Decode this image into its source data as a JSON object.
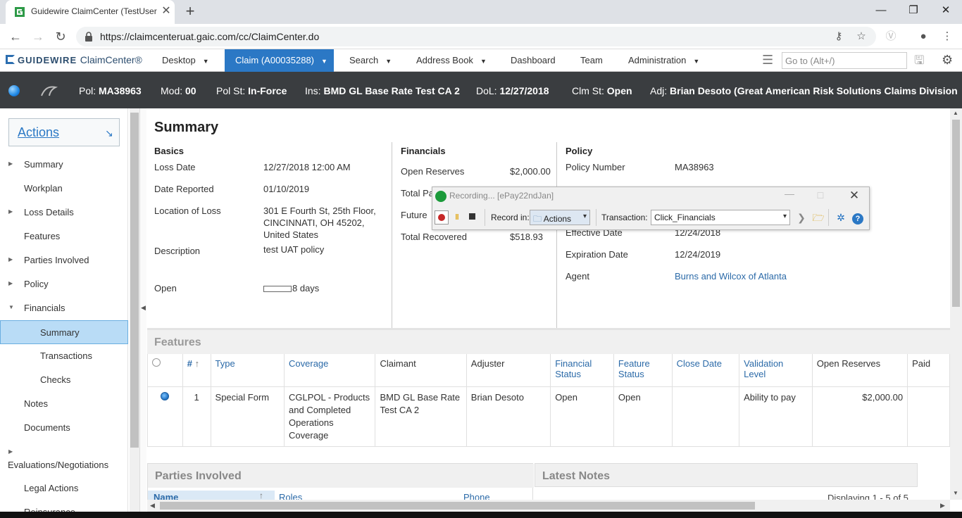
{
  "browser": {
    "tab_title": "Guidewire ClaimCenter (TestUser",
    "url": "https://claimcenteruat.gaic.com/cc/ClaimCenter.do"
  },
  "nav": {
    "logo": "GUIDEWIRE",
    "product": "ClaimCenter®",
    "items": [
      "Desktop",
      "Claim (A00035288)",
      "Search",
      "Address Book",
      "Dashboard",
      "Team",
      "Administration"
    ],
    "goto_placeholder": "Go to (Alt+/)"
  },
  "infobar": {
    "pol_label": "Pol:",
    "pol": "MA38963",
    "mod_label": "Mod:",
    "mod": "00",
    "polst_label": "Pol St:",
    "polst": "In-Force",
    "ins_label": "Ins:",
    "ins": "BMD GL Base Rate Test CA 2",
    "dol_label": "DoL:",
    "dol": "12/27/2018",
    "clmst_label": "Clm St:",
    "clmst": "Open",
    "adj_label": "Adj:",
    "adj": "Brian Desoto (Great American Risk Solutions Claims Division"
  },
  "sidebar": {
    "actions": "Actions",
    "items": [
      "Summary",
      "Workplan",
      "Loss Details",
      "Features",
      "Parties Involved",
      "Policy",
      "Financials",
      "Summary",
      "Transactions",
      "Checks",
      "Notes",
      "Documents",
      "Evaluations/Negotiations",
      "Legal Actions",
      "Reinsurance"
    ]
  },
  "main": {
    "title": "Summary",
    "basics": {
      "heading": "Basics",
      "loss_date_label": "Loss Date",
      "loss_date": "12/27/2018 12:00 AM",
      "date_reported_label": "Date Reported",
      "date_reported": "01/10/2019",
      "location_label": "Location of Loss",
      "location_1": "301 E Fourth St, 25th Floor,",
      "location_2": "CINCINNATI, OH 45202,",
      "location_3": "United States",
      "description_label": "Description",
      "description": "test UAT policy",
      "open_label": "Open",
      "open_value": "8 days"
    },
    "financials": {
      "heading": "Financials",
      "open_reserves_label": "Open Reserves",
      "open_reserves": "$2,000.00",
      "total_paid_label": "Total Pa",
      "future_label": "Future",
      "total_recovered_label": "Total Recovered",
      "total_recovered": "$518.93"
    },
    "policy": {
      "heading": "Policy",
      "policy_number_label": "Policy Number",
      "policy_number": "MA38963",
      "effective_label": "Effective Date",
      "effective": "12/24/2018",
      "expiration_label": "Expiration Date",
      "expiration": "12/24/2019",
      "agent_label": "Agent",
      "agent": "Burns and Wilcox of Atlanta"
    },
    "features": {
      "heading": "Features",
      "columns": [
        "#",
        "Type",
        "Coverage",
        "Claimant",
        "Adjuster",
        "Financial Status",
        "Feature Status",
        "Close Date",
        "Validation Level",
        "Open Reserves",
        "Paid"
      ],
      "row": {
        "num": "1",
        "type": "Special Form",
        "coverage": "CGLPOL - Products and Completed Operations Coverage",
        "claimant": "BMD GL Base Rate Test CA 2",
        "adjuster": "Brian Desoto",
        "financial_status": "Open",
        "feature_status": "Open",
        "close_date": "",
        "validation": "Ability to pay",
        "open_reserves": "$2,000.00",
        "paid": ""
      }
    },
    "parties": {
      "heading": "Parties Involved",
      "col_name": "Name",
      "col_roles": "Roles",
      "col_phone": "Phone"
    },
    "notes": {
      "heading": "Latest Notes",
      "displaying": "Displaying 1 - 5 of 5"
    }
  },
  "recorder": {
    "title": "Recording... [ePay22ndJan]",
    "record_in_label": "Record in:",
    "record_in": "Actions",
    "transaction_label": "Transaction:",
    "transaction": "Click_Financials"
  }
}
